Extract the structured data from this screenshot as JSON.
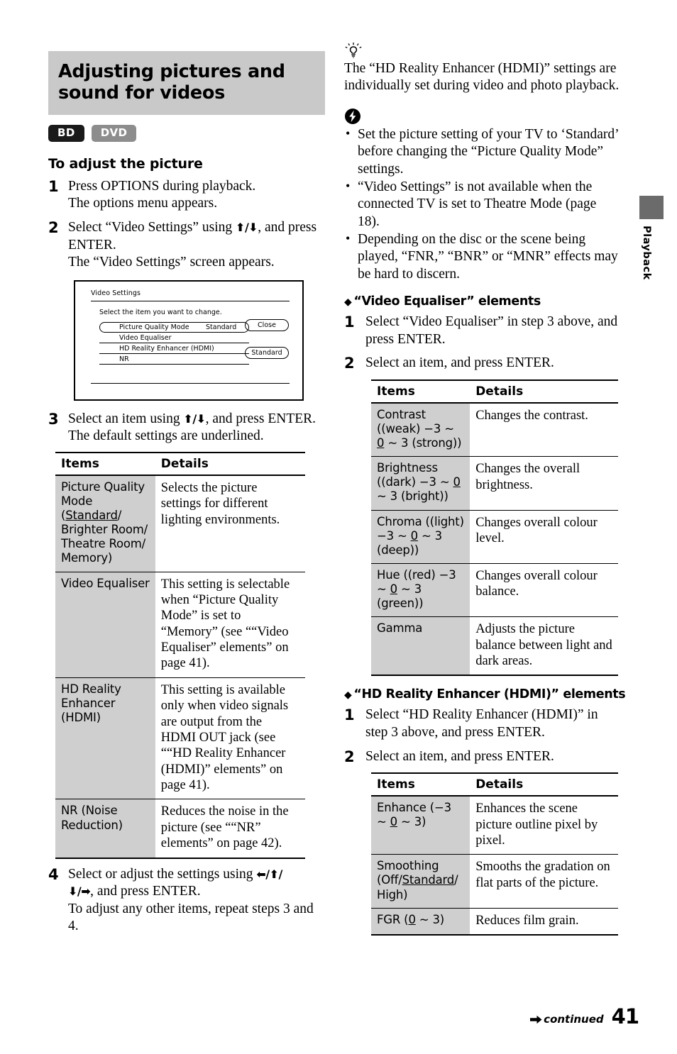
{
  "page": {
    "number": "41",
    "continued_label": "continued",
    "side_tab": "Playback"
  },
  "title": "Adjusting pictures and sound for videos",
  "badges": [
    {
      "label": "BD",
      "color": "#1a1a1a"
    },
    {
      "label": "DVD",
      "color": "#8d8d8d"
    }
  ],
  "left": {
    "section_heading": "To adjust the picture",
    "steps": [
      {
        "num": "1",
        "lines": [
          "Press OPTIONS during playback.",
          "The options menu appears."
        ]
      },
      {
        "num": "2",
        "line_a": "Select “Video Settings” using ",
        "arrows": "⬆/⬇",
        "line_b": ", and press ENTER.",
        "line_c": "The “Video Settings” screen appears."
      },
      {
        "num": "3",
        "line_a": "Select an item using ",
        "arrows": "⬆/⬇",
        "line_b": ", and press ENTER.",
        "line_c": "The default settings are underlined."
      },
      {
        "num": "4",
        "line_a": "Select or adjust the settings using ",
        "arrows_a": "⬅/⬆/",
        "arrows_b": "⬇/➡",
        "line_b": ", and press ENTER.",
        "line_c": "To adjust any other items, repeat steps 3 and 4."
      }
    ],
    "screen": {
      "title": "Video Settings",
      "instruction": "Select the item you want to change.",
      "rows": [
        {
          "label": "Picture Quality Mode",
          "value": "Standard",
          "highlighted": true
        },
        {
          "label": "Video Equaliser",
          "value": "",
          "highlighted": false
        },
        {
          "label": "HD Reality Enhancer (HDMI)",
          "value": "",
          "highlighted": false
        },
        {
          "label": "NR",
          "value": "",
          "highlighted": false
        }
      ],
      "buttons": [
        {
          "label": "Close"
        },
        {
          "label": "Standard"
        }
      ]
    },
    "table": {
      "headers": [
        "Items",
        "Details"
      ],
      "rows": [
        {
          "item_pre": "Picture Quality Mode (",
          "item_underline": "Standard",
          "item_post": "/ Brighter Room/ Theatre Room/ Memory)",
          "detail": "Selects the picture settings for different lighting environments."
        },
        {
          "item_pre": "Video Equaliser",
          "item_underline": "",
          "item_post": "",
          "detail": "This setting is selectable when “Picture Quality Mode” is set to “Memory” (see ““Video Equaliser” elements” on page 41)."
        },
        {
          "item_pre": "HD Reality Enhancer (HDMI)",
          "item_underline": "",
          "item_post": "",
          "detail": "This setting is available only when video signals are output from the HDMI OUT jack (see ““HD Reality Enhancer (HDMI)” elements” on page 41)."
        },
        {
          "item_pre": "NR (Noise Reduction)",
          "item_underline": "",
          "item_post": "",
          "detail": "Reduces the noise in the picture (see ““NR” elements” on page 42)."
        }
      ]
    }
  },
  "right": {
    "tip": "The “HD Reality Enhancer (HDMI)” settings are individually set during video and photo playback.",
    "notes": [
      "Set the picture setting of your TV to ‘Standard’ before changing the “Picture Quality Mode” settings.",
      "“Video Settings” is not available when the connected TV is set to Theatre Mode (page 18).",
      "Depending on the disc or the scene being played, “FNR,” “BNR” or “MNR” effects may be hard to discern."
    ],
    "equaliser": {
      "heading": "“Video Equaliser” elements",
      "steps": [
        {
          "num": "1",
          "text": "Select “Video Equaliser” in step 3 above, and press ENTER."
        },
        {
          "num": "2",
          "text": "Select an item, and press ENTER."
        }
      ],
      "table": {
        "headers": [
          "Items",
          "Details"
        ],
        "rows": [
          {
            "item_pre": "Contrast ((weak) −3 ~ ",
            "item_underline": "0",
            "item_post": " ~ 3 (strong))",
            "detail": "Changes the contrast."
          },
          {
            "item_pre": "Brightness ((dark) −3 ~ ",
            "item_underline": "0",
            "item_post": " ~ 3 (bright))",
            "detail": "Changes the overall brightness."
          },
          {
            "item_pre": "Chroma ((light) −3 ~ ",
            "item_underline": "0",
            "item_post": " ~ 3 (deep))",
            "detail": "Changes overall colour level."
          },
          {
            "item_pre": "Hue ((red) −3 ~ ",
            "item_underline": "0",
            "item_post": " ~ 3 (green))",
            "detail": "Changes overall colour balance."
          },
          {
            "item_pre": "Gamma",
            "item_underline": "",
            "item_post": "",
            "detail": "Adjusts the picture balance between light and dark areas."
          }
        ]
      }
    },
    "hdre": {
      "heading": "“HD Reality Enhancer (HDMI)” elements",
      "steps": [
        {
          "num": "1",
          "text": "Select “HD Reality Enhancer (HDMI)” in step 3 above, and press ENTER."
        },
        {
          "num": "2",
          "text": "Select an item, and press ENTER."
        }
      ],
      "table": {
        "headers": [
          "Items",
          "Details"
        ],
        "rows": [
          {
            "item_pre": "Enhance (−3 ~ ",
            "item_underline": "0",
            "item_post": " ~ 3)",
            "detail": "Enhances the scene picture outline pixel by pixel."
          },
          {
            "item_pre": "Smoothing (Off/",
            "item_underline": "Standard",
            "item_post": "/ High)",
            "detail": "Smooths the gradation on flat parts of the picture."
          },
          {
            "item_pre": "FGR (",
            "item_underline": "0",
            "item_post": " ~ 3)",
            "detail": "Reduces film grain."
          }
        ]
      }
    }
  }
}
